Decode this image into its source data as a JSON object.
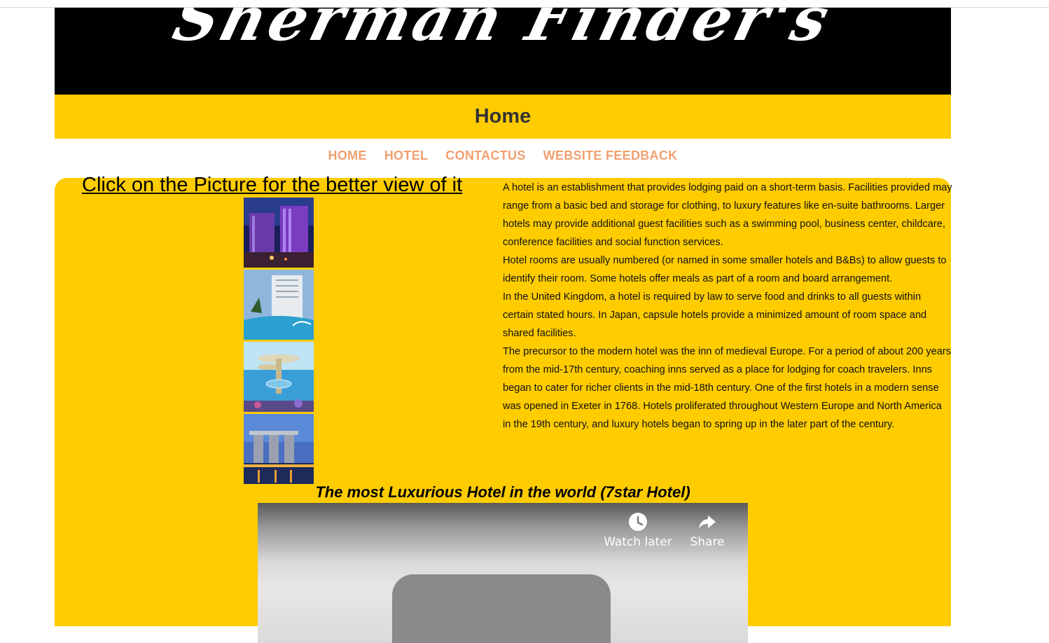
{
  "header": {
    "site_title": "Sherman Finder's",
    "page_title": "Home"
  },
  "nav": {
    "items": [
      "HOME",
      "HOTEL",
      "CONTACTUS",
      "WEBSITE FEEDBACK"
    ]
  },
  "gallery": {
    "title": "Click on the Picture for the better view of it",
    "images": [
      "hotel-photo-1",
      "hotel-photo-2",
      "hotel-photo-3",
      "hotel-photo-4"
    ]
  },
  "info": {
    "paragraphs": [
      "A hotel is an establishment that provides lodging paid on a short-term basis. Facilities provided may range from a basic bed and storage for clothing, to luxury features like en-suite bathrooms. Larger hotels may provide additional guest facilities such as a swimming pool, business center, childcare, conference facilities and social function services.",
      "Hotel rooms are usually numbered (or named in some smaller hotels and B&Bs) to allow guests to identify their room. Some hotels offer meals as part of a room and board arrangement.",
      "In the United Kingdom, a hotel is required by law to serve food and drinks to all guests within certain stated hours. In Japan, capsule hotels provide a minimized amount of room space and shared facilities.",
      "The precursor to the modern hotel was the inn of medieval Europe. For a period of about 200 years from the mid-17th century, coaching inns served as a place for lodging for coach travelers. Inns began to cater for richer clients in the mid-18th century. One of the first hotels in a modern sense was opened in Exeter in 1768. Hotels proliferated throughout Western Europe and North America in the 19th century, and luxury hotels began to spring up in the later part of the century."
    ]
  },
  "video": {
    "caption": "The most Luxurious Hotel in the world (7star Hotel)",
    "watch_later_label": "Watch later",
    "share_label": "Share"
  },
  "colors": {
    "banner": "#000000",
    "accent": "#ffcc00",
    "nav": "#f0a070"
  }
}
